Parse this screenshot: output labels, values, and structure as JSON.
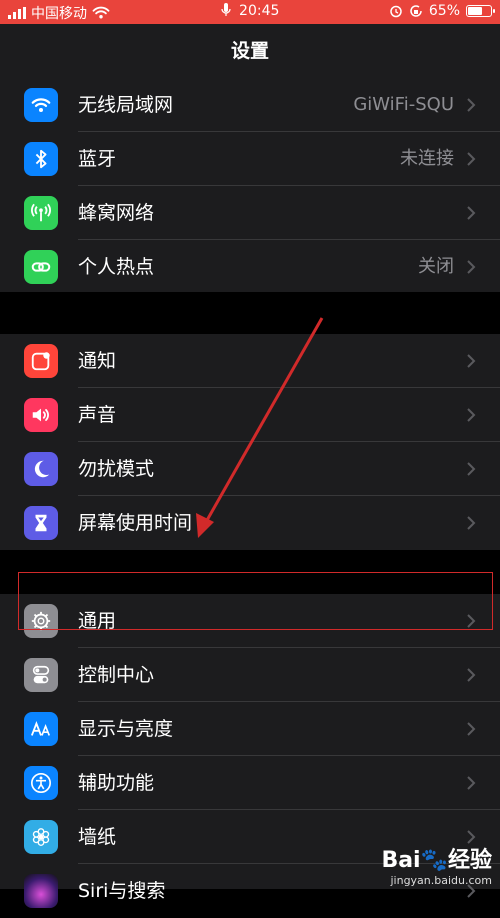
{
  "status_bar": {
    "carrier": "中国移动",
    "time": "20:45",
    "battery_percent": "65%",
    "battery_level": 0.65,
    "bg_color": "#e9443c"
  },
  "nav": {
    "title": "设置"
  },
  "groups": [
    [
      {
        "label": "无线局域网",
        "value": "GiWiFi-SQU",
        "icon": "wifi-icon",
        "color": "#0a84ff"
      },
      {
        "label": "蓝牙",
        "value": "未连接",
        "icon": "bluetooth-icon",
        "color": "#0a84ff"
      },
      {
        "label": "蜂窝网络",
        "value": "",
        "icon": "cellular-antenna-icon",
        "color": "#30d158"
      },
      {
        "label": "个人热点",
        "value": "关闭",
        "icon": "hotspot-link-icon",
        "color": "#30d158"
      }
    ],
    [
      {
        "label": "通知",
        "value": "",
        "icon": "notification-icon",
        "color": "#ff453a"
      },
      {
        "label": "声音",
        "value": "",
        "icon": "speaker-icon",
        "color": "#ff375f"
      },
      {
        "label": "勿扰模式",
        "value": "",
        "icon": "moon-icon",
        "color": "#5e5ce6"
      },
      {
        "label": "屏幕使用时间",
        "value": "",
        "icon": "hourglass-icon",
        "color": "#5e5ce6"
      }
    ],
    [
      {
        "label": "通用",
        "value": "",
        "icon": "gear-icon",
        "color": "#8e8e93"
      },
      {
        "label": "控制中心",
        "value": "",
        "icon": "toggles-icon",
        "color": "#8e8e93"
      },
      {
        "label": "显示与亮度",
        "value": "",
        "icon": "text-size-icon",
        "color": "#0a84ff"
      },
      {
        "label": "辅助功能",
        "value": "",
        "icon": "accessibility-icon",
        "color": "#0a84ff"
      },
      {
        "label": "墙纸",
        "value": "",
        "icon": "flower-icon",
        "color": "#32ade6"
      },
      {
        "label": "Siri与搜索",
        "value": "",
        "icon": "siri-icon",
        "color": "#1c1c1e"
      }
    ]
  ],
  "annotation": {
    "arrow_color": "#d12a2a",
    "highlight_color": "#d12a2a"
  },
  "watermark": {
    "logo": "Bai🐾经验",
    "url": "jingyan.baidu.com"
  }
}
